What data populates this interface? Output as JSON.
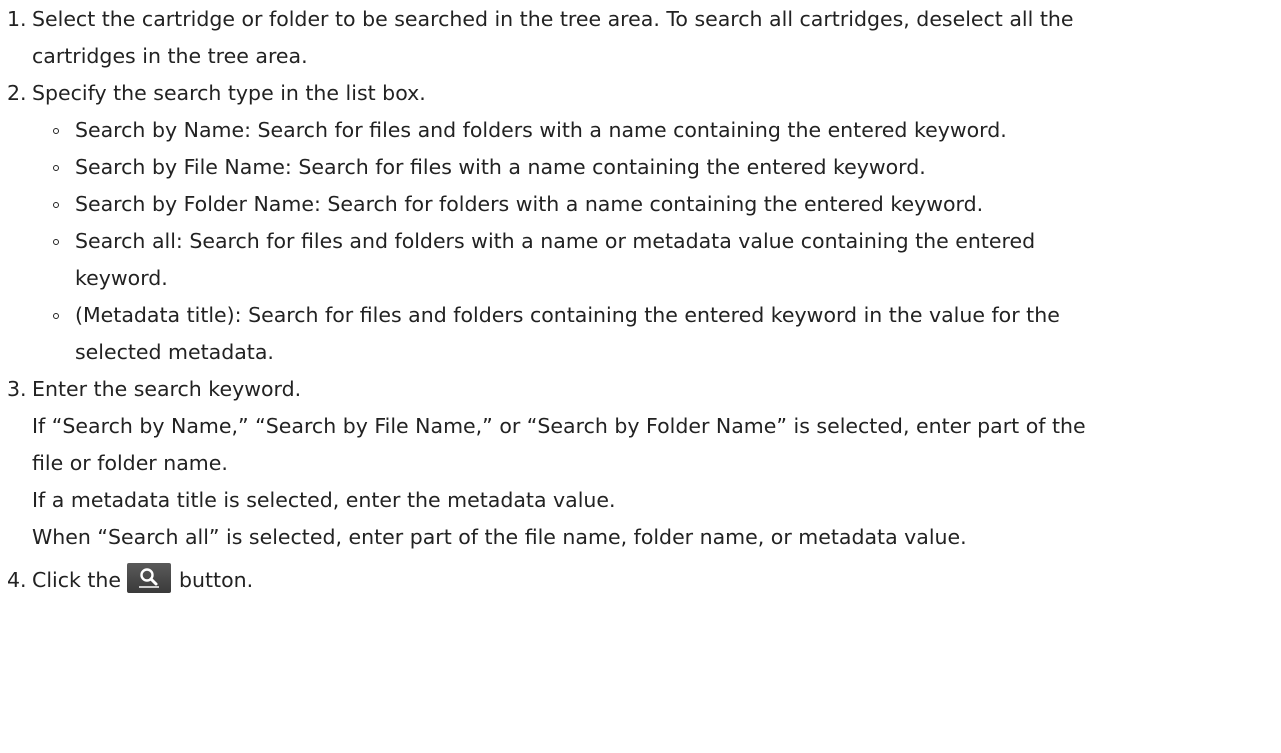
{
  "steps": [
    {
      "number": "1.",
      "lines": [
        "Select the cartridge or folder to be searched in the tree area. To search all cartridges, deselect all the",
        "cartridges in the tree area."
      ]
    },
    {
      "number": "2.",
      "lines": [
        "Specify the search type in the list box."
      ],
      "bullets": [
        {
          "lines": [
            "Search by Name: Search for files and folders with a name containing the entered keyword."
          ]
        },
        {
          "lines": [
            "Search by File Name: Search for files with a name containing the entered keyword."
          ]
        },
        {
          "lines": [
            "Search by Folder Name: Search for folders with a name containing the entered keyword."
          ]
        },
        {
          "lines": [
            "Search all: Search for files and folders with a name or metadata value containing the entered",
            "keyword."
          ]
        },
        {
          "lines": [
            "(Metadata title): Search for files and folders containing the entered keyword in the value for the",
            "selected metadata."
          ]
        }
      ]
    },
    {
      "number": "3.",
      "lines": [
        "Enter the search keyword.",
        "If “Search by Name,” “Search by File Name,” or “Search by Folder Name” is selected, enter part of the",
        "file or folder name.",
        "If a metadata title is selected, enter the metadata value.",
        "When “Search all” is selected, enter part of the file name, folder name, or metadata value."
      ]
    },
    {
      "number": "4.",
      "before_button": "Click the",
      "button_icon": "search-icon",
      "after_button": "button."
    }
  ],
  "colors": {
    "text": "#222222",
    "button_bg": "#4a4a4a",
    "icon": "#ffffff"
  }
}
